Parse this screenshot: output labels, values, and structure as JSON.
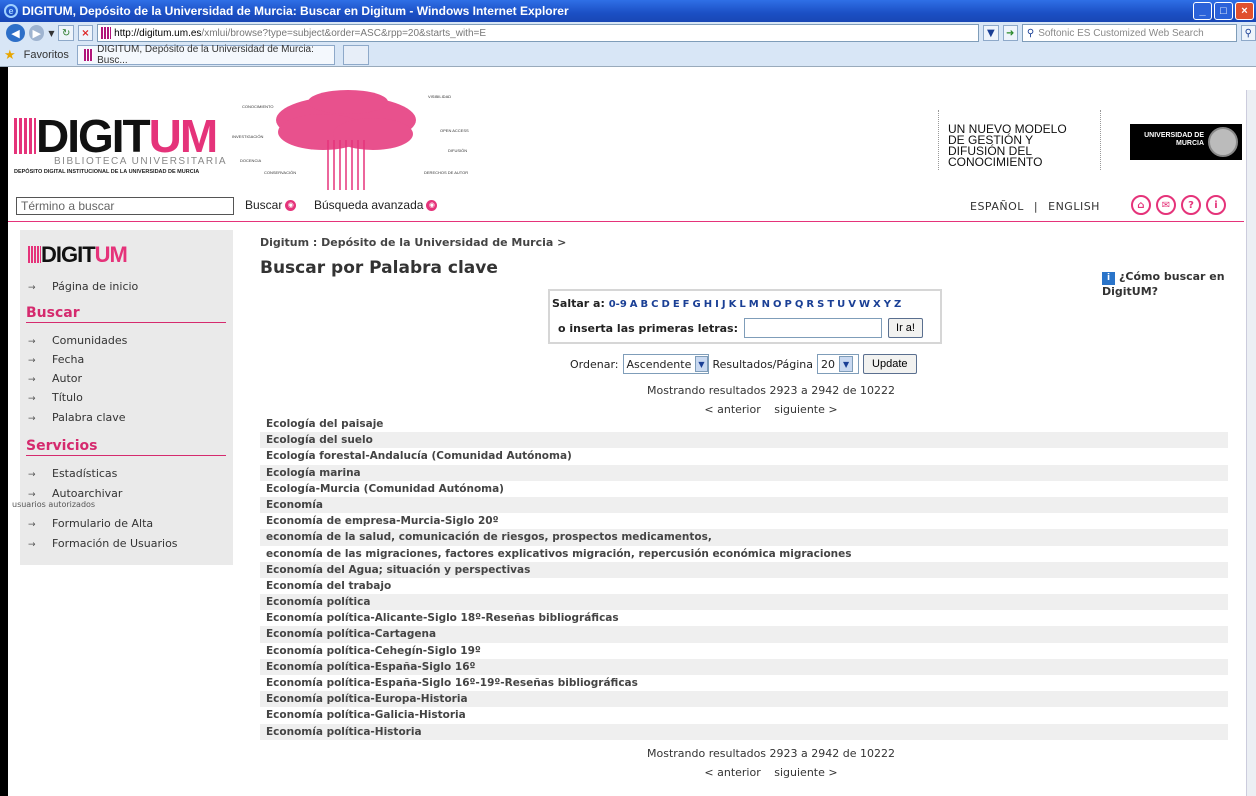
{
  "window": {
    "title": "DIGITUM, Depósito de la Universidad de Murcia: Buscar en Digitum - Windows Internet Explorer",
    "url_host": "http://digitum.um.es",
    "url_path": "/xmlui/browse?type=subject&order=ASC&rpp=20&starts_with=E",
    "search_placeholder": "Softonic ES Customized Web Search",
    "favorites_label": "Favoritos",
    "tab_title": "DIGITUM, Depósito de la Universidad de Murcia: Busc..."
  },
  "header": {
    "logo_main": "DIGIT",
    "logo_accent": "UM",
    "logo_sub": "BIBLIOTECA UNIVERSITARIA",
    "logo_caption": "DEPÓSITO DIGITAL INSTITUCIONAL DE LA UNIVERSIDAD DE MURCIA",
    "tree_words": [
      "CONOCIMIENTO",
      "INVESTIGACIÓN",
      "DOCENCIA",
      "CONSERVACIÓN",
      "VISIBILIDAD",
      "OPEN ACCESS",
      "DIFUSIÓN",
      "DERECHOS DE AUTOR"
    ],
    "motto": "UN NUEVO MODELO\nDE GESTIÓN Y\nDIFUSIÓN DEL\nCONOCIMIENTO",
    "university": "UNIVERSIDAD DE\nMURCIA"
  },
  "searchbar": {
    "placeholder": "Término a buscar",
    "buscar": "Buscar",
    "avanzada": "Búsqueda avanzada",
    "lang_es": "ESPAÑOL",
    "lang_sep": "|",
    "lang_en": "ENGLISH"
  },
  "sidebar": {
    "logo_main": "DIGIT",
    "logo_accent": "UM",
    "home": "Página de inicio",
    "buscar_head": "Buscar",
    "buscar_items": [
      "Comunidades",
      "Fecha",
      "Autor",
      "Título",
      "Palabra clave"
    ],
    "servicios_head": "Servicios",
    "servicios_items": [
      "Estadísticas",
      "Autoarchivar",
      "Formulario de Alta",
      "Formación de Usuarios"
    ],
    "autoarchivar_note": "usuarios autorizados"
  },
  "main": {
    "breadcrumb": "Digitum : Depósito de la Universidad de Murcia >",
    "title": "Buscar por Palabra clave",
    "help": "¿Cómo buscar en DigitUM?",
    "jump_label": "Saltar a:",
    "jump_letters": [
      "0-9",
      "A",
      "B",
      "C",
      "D",
      "E",
      "F",
      "G",
      "H",
      "I",
      "J",
      "K",
      "L",
      "M",
      "N",
      "O",
      "P",
      "Q",
      "R",
      "S",
      "T",
      "U",
      "V",
      "W",
      "X",
      "Y",
      "Z"
    ],
    "jump_input_label": "o inserta las primeras letras:",
    "jump_button": "Ir a!",
    "order_label": "Ordenar:",
    "order_value": "Ascendente",
    "rpp_label": "Resultados/Página",
    "rpp_value": "20",
    "update_button": "Update",
    "showing": "Mostrando resultados 2923 a 2942 de 10222",
    "prev": "< anterior",
    "next": "siguiente >",
    "results": [
      "Ecología del paisaje",
      "Ecología del suelo",
      "Ecología forestal-Andalucía (Comunidad Autónoma)",
      "Ecología marina",
      "Ecología-Murcia (Comunidad Autónoma)",
      "Economía",
      "Economía de empresa-Murcia-Siglo 20º",
      "economía de la salud, comunicación de riesgos, prospectos medicamentos,",
      "economía de las migraciones, factores explicativos migración, repercusión económica migraciones",
      "Economía del Agua; situación y perspectivas",
      "Economía del trabajo",
      "Economía política",
      "Economía política-Alicante-Siglo 18º-Reseñas bibliográficas",
      "Economía política-Cartagena",
      "Economía política-Cehegín-Siglo 19º",
      "Economía política-España-Siglo 16º",
      "Economía política-España-Siglo 16º-19º-Reseñas bibliográficas",
      "Economía política-Europa-Historia",
      "Economía política-Galicia-Historia",
      "Economía política-Historia"
    ]
  }
}
